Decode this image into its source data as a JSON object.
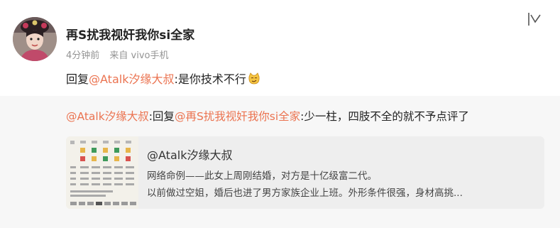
{
  "post": {
    "username": "再S扰我视奸我你si全家",
    "time": "4分钟前",
    "source": "来自 vivo手机",
    "reply_prefix": "回复",
    "reply_mention": "@Atalk汐缘大叔",
    "reply_text": ":是你技术不行",
    "emoji": "smirk-cat-emoji"
  },
  "quoted": {
    "author_mention": "@Atalk汐缘大叔",
    "sep": ":回复",
    "target_mention": "@再S扰我视奸我你si全家",
    "text": ":少一柱，四肢不全的就不予点评了",
    "card": {
      "title": "@Atalk汐缘大叔",
      "line1": "网络命例——此女上周刚结婚，对方是十亿级富二代。",
      "line2": "以前做过空姐，婚后也进了男方家族企业上班。外形条件很强，身材高挑..."
    }
  },
  "colors": {
    "mention": "#eb7350",
    "quoted_bg": "#f7f7f7",
    "card_bg": "#eeeeee"
  }
}
